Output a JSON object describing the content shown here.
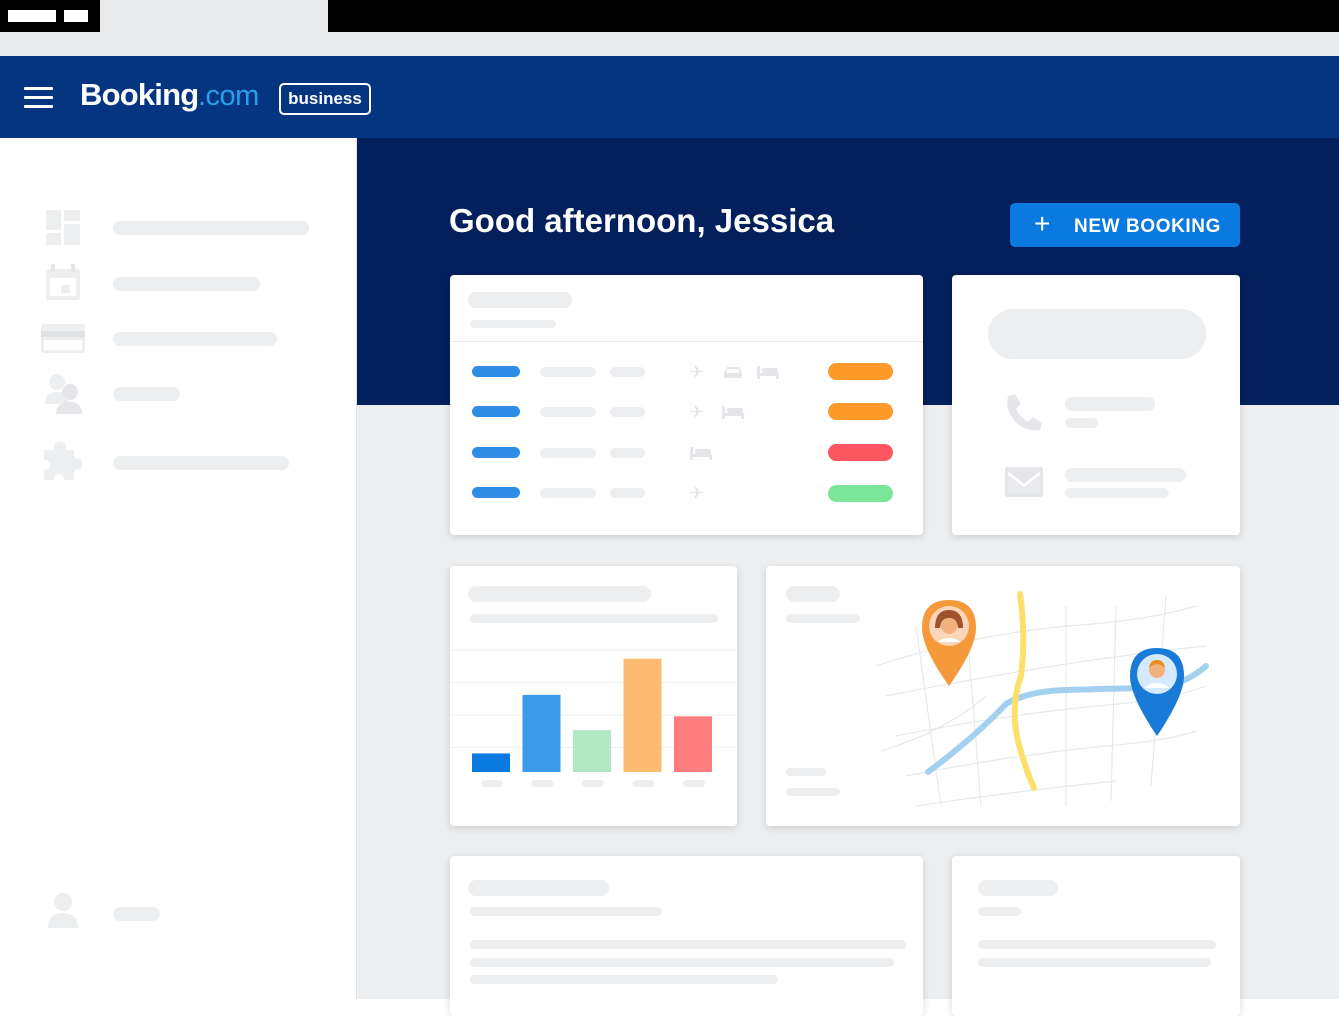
{
  "brand": {
    "name": "Booking",
    "tld": ".com",
    "badge": "business",
    "header_color": "#053580",
    "hero_color": "#03205c",
    "accent_color": "#2b9eea"
  },
  "header": {
    "menu_icon": "hamburger-icon"
  },
  "sidebar": {
    "items": [
      {
        "icon": "dashboard-icon"
      },
      {
        "icon": "calendar-icon"
      },
      {
        "icon": "credit-card-icon"
      },
      {
        "icon": "people-icon"
      },
      {
        "icon": "puzzle-icon"
      }
    ],
    "profile_icon": "user-avatar-icon"
  },
  "main": {
    "greeting": "Good afternoon, Jessica",
    "new_booking": {
      "icon": "plus-icon",
      "label": "NEW BOOKING",
      "color": "#0a79e0"
    }
  },
  "bookings_card": {
    "rows": [
      {
        "icons": [
          "plane-icon",
          "car-icon",
          "bed-icon"
        ],
        "status_color": "#fd9a2a"
      },
      {
        "icons": [
          "plane-icon",
          "bed-icon"
        ],
        "status_color": "#fd9a2a"
      },
      {
        "icons": [
          "bed-icon"
        ],
        "status_color": "#fb5661"
      },
      {
        "icons": [
          "plane-icon"
        ],
        "status_color": "#79e69a"
      }
    ]
  },
  "contact_card": {
    "icons": [
      "phone-icon",
      "mail-icon"
    ]
  },
  "chart_data": {
    "type": "bar",
    "title": "",
    "xlabel": "",
    "ylabel": "",
    "categories": [
      "",
      "",
      "",
      "",
      ""
    ],
    "values": [
      2,
      8.3,
      4.5,
      12.2,
      6
    ],
    "colors": [
      "#0a79e0",
      "#3a99e8",
      "#b0e9c3",
      "#fdbb72",
      "#fe7e80"
    ],
    "ylim": [
      0,
      14
    ],
    "grid": true
  },
  "map_card": {
    "pins": [
      {
        "icon": "traveler-pin-icon",
        "color": "#f5993a"
      },
      {
        "icon": "traveler-pin-icon",
        "color": "#1a7ad8"
      }
    ],
    "road_color": "#fbe06b",
    "river_color": "#a4d0f0"
  }
}
